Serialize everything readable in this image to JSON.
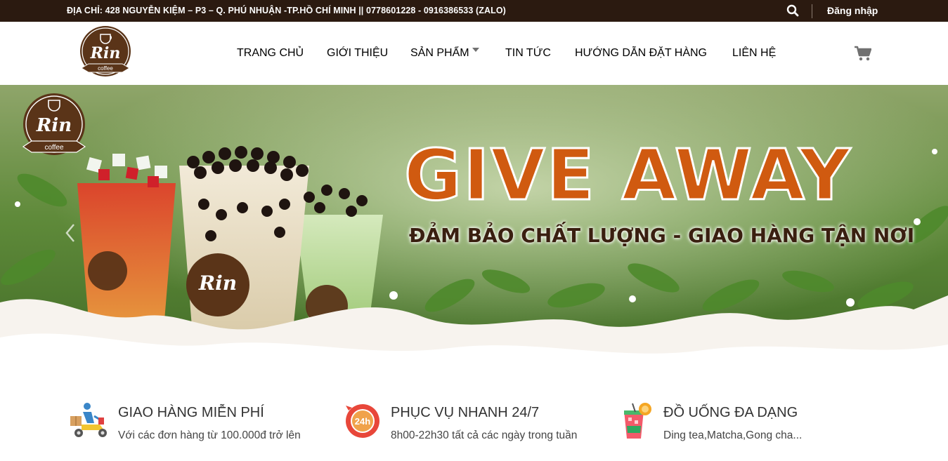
{
  "topbar": {
    "address": "ĐỊA CHỈ: 428 NGUYỄN KIỆM – P3 – Q. PHÚ NHUẬN -TP.HỒ CHÍ MINH || 0778601228 - 0916386533 (ZALO)",
    "search_icon": "search-icon",
    "login_label": "Đăng nhập"
  },
  "header": {
    "logo_text": "Rin",
    "logo_sub": "coffee",
    "nav": [
      {
        "label": "TRANG CHỦ"
      },
      {
        "label": "GIỚI THIỆU"
      },
      {
        "label": "SẢN PHẨM"
      },
      {
        "label": "TIN TỨC"
      },
      {
        "label": "HƯỚNG DẪN ĐẶT HÀNG"
      },
      {
        "label": "LIÊN HỆ"
      }
    ],
    "cart_icon": "cart-icon"
  },
  "banner": {
    "headline": "GIVE AWAY",
    "tagline": "ĐẢM BẢO CHẤT LƯỢNG - GIAO HÀNG TẬN NƠI",
    "logo_text": "Rin",
    "logo_sub": "coffee"
  },
  "features": [
    {
      "title": "GIAO HÀNG MIỄN PHÍ",
      "desc": "Với các đơn hàng từ 100.000đ trở lên",
      "icon": "delivery-icon"
    },
    {
      "title": "PHỤC VỤ NHANH 24/7",
      "desc": "8h00-22h30 tất cả các ngày trong tuần",
      "icon": "24h-icon",
      "badge": "24h"
    },
    {
      "title": "ĐỒ UỐNG ĐA DẠNG",
      "desc": "Ding tea,Matcha,Gong cha...",
      "icon": "drink-icon"
    }
  ],
  "colors": {
    "topbar_bg": "#2b1a10",
    "nav_text": "#707070",
    "brand_brown": "#5a3418",
    "headline_orange": "#d05a10"
  }
}
